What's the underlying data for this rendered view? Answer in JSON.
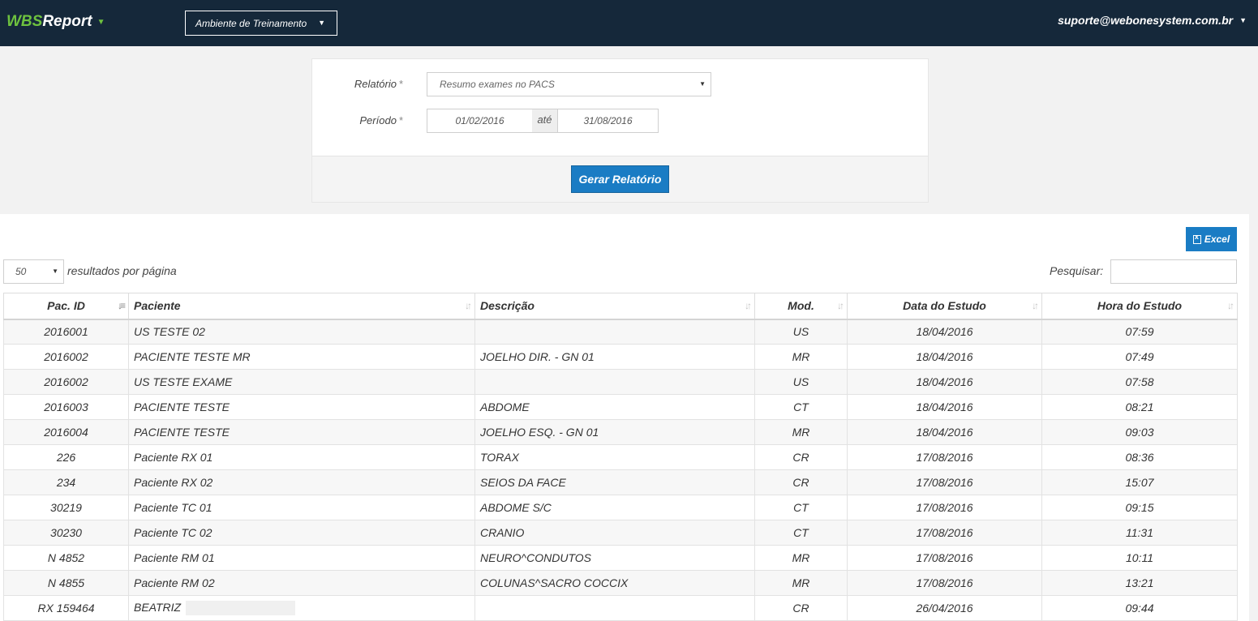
{
  "navbar": {
    "brand_prefix": "WBS",
    "brand_suffix": "Report",
    "environment": "Ambiente de Treinamento",
    "user_email": "suporte@webonesystem.com.br"
  },
  "filter": {
    "report_label": "Relatório",
    "report_value": "Resumo exames no PACS",
    "period_label": "Período",
    "required_mark": "*",
    "date_from": "01/02/2016",
    "date_sep": "até",
    "date_to": "31/08/2016",
    "generate_button": "Gerar Relatório"
  },
  "results": {
    "excel_button": "Excel",
    "page_length": "50",
    "page_length_label": "resultados por página",
    "search_label": "Pesquisar:",
    "search_value": "",
    "columns": [
      "Pac. ID",
      "Paciente",
      "Descrição",
      "Mod.",
      "Data do Estudo",
      "Hora do Estudo"
    ],
    "rows": [
      [
        "2016001",
        "US TESTE 02",
        "",
        "US",
        "18/04/2016",
        "07:59"
      ],
      [
        "2016002",
        "PACIENTE TESTE MR",
        "JOELHO DIR. - GN 01",
        "MR",
        "18/04/2016",
        "07:49"
      ],
      [
        "2016002",
        "US TESTE EXAME",
        "",
        "US",
        "18/04/2016",
        "07:58"
      ],
      [
        "2016003",
        "PACIENTE TESTE",
        "ABDOME",
        "CT",
        "18/04/2016",
        "08:21"
      ],
      [
        "2016004",
        "PACIENTE TESTE",
        "JOELHO ESQ. - GN 01",
        "MR",
        "18/04/2016",
        "09:03"
      ],
      [
        "226",
        "Paciente RX 01",
        "TORAX",
        "CR",
        "17/08/2016",
        "08:36"
      ],
      [
        "234",
        "Paciente RX 02",
        "SEIOS DA FACE",
        "CR",
        "17/08/2016",
        "15:07"
      ],
      [
        "30219",
        "Paciente TC 01",
        "ABDOME S/C",
        "CT",
        "17/08/2016",
        "09:15"
      ],
      [
        "30230",
        "Paciente TC 02",
        "CRANIO",
        "CT",
        "17/08/2016",
        "11:31"
      ],
      [
        "N 4852",
        "Paciente RM 01",
        "NEURO^CONDUTOS",
        "MR",
        "17/08/2016",
        "10:11"
      ],
      [
        "N 4855",
        "Paciente RM 02",
        "COLUNAS^SACRO COCCIX",
        "MR",
        "17/08/2016",
        "13:21"
      ],
      [
        "RX 159464",
        "BEATRIZ",
        "",
        "CR",
        "26/04/2016",
        "09:44"
      ]
    ]
  }
}
